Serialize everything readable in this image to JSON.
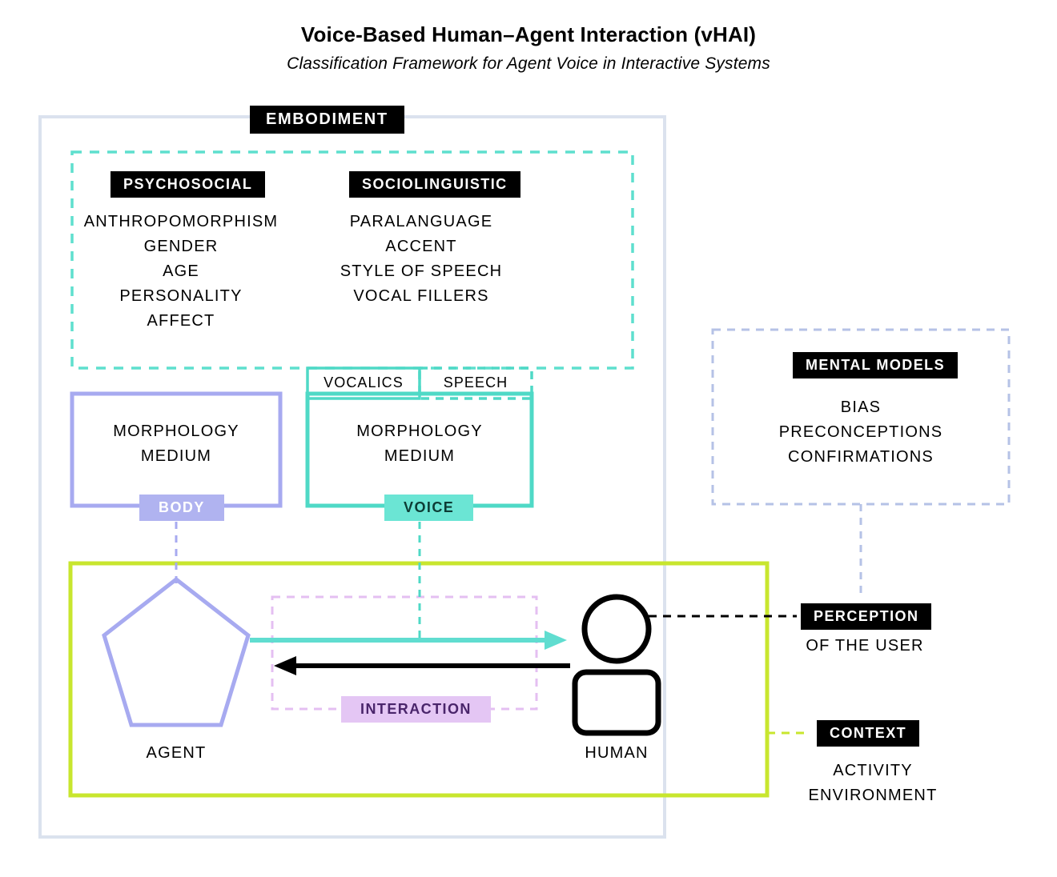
{
  "title": "Voice-Based Human–Agent Interaction (vHAI)",
  "subtitle": "Classification Framework for Agent Voice in Interactive Systems",
  "embodiment": {
    "tag": "EMBODIMENT",
    "psychosocial": {
      "tag": "PSYCHOSOCIAL",
      "items": {
        "a0": "ANTHROPOMORPHISM",
        "a1": "GENDER",
        "a2": "AGE",
        "a3": "PERSONALITY",
        "a4": "AFFECT"
      }
    },
    "sociolinguistic": {
      "tag": "SOCIOLINGUISTIC",
      "items": {
        "a0": "PARALANGUAGE",
        "a1": "ACCENT",
        "a2": "STYLE OF SPEECH",
        "a3": "VOCAL FILLERS"
      }
    },
    "body": {
      "label": "BODY",
      "items": {
        "a0": "MORPHOLOGY",
        "a1": "MEDIUM"
      }
    },
    "voice": {
      "label": "VOICE",
      "sub_vocalics": "VOCALICS",
      "sub_speech": "SPEECH",
      "items": {
        "a0": "MORPHOLOGY",
        "a1": "MEDIUM"
      }
    }
  },
  "agent": "AGENT",
  "human": "HUMAN",
  "interaction": {
    "label": "INTERACTION"
  },
  "mental_models": {
    "tag": "MENTAL MODELS",
    "items": {
      "a0": "BIAS",
      "a1": "PRECONCEPTIONS",
      "a2": "CONFIRMATIONS"
    }
  },
  "perception": {
    "tag": "PERCEPTION",
    "sub": "OF THE USER"
  },
  "context": {
    "tag": "CONTEXT",
    "items": {
      "a0": "ACTIVITY",
      "a1": "ENVIRONMENT"
    }
  },
  "colors": {
    "embodiment_frame": "#dbe2ee",
    "dashed_teal": "#5edfce",
    "body_purple": "#a7aaf0",
    "voice_teal": "#4fd9c6",
    "context_lime": "#c8e62e",
    "interaction_pink": "#e4bff2",
    "mental_blue": "#b5c2e6",
    "arrow_teal": "#60ddd0",
    "arrow_black": "#000"
  }
}
